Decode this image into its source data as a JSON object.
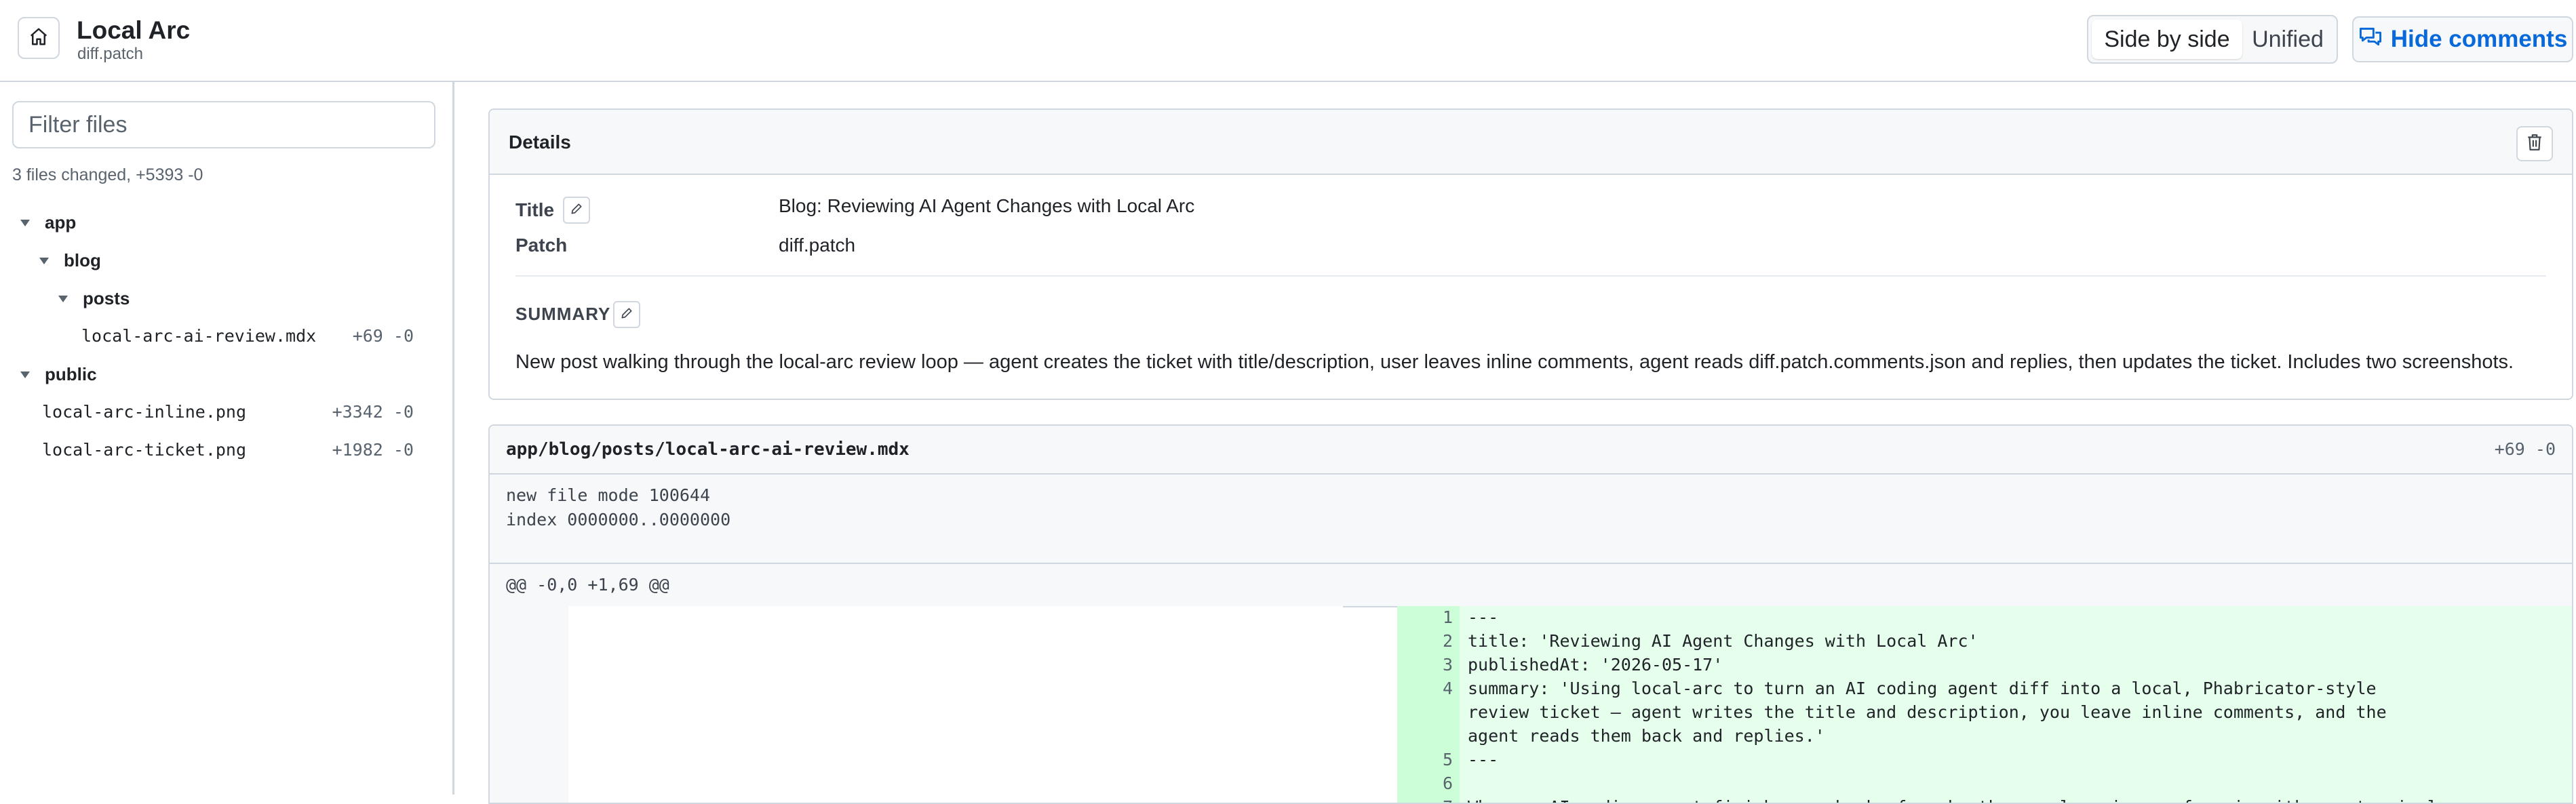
{
  "header": {
    "title": "Local Arc",
    "subtitle": "diff.patch",
    "view_modes": [
      "Side by side",
      "Unified"
    ],
    "active_view": "Side by side",
    "hide_comments_label": "Hide comments"
  },
  "sidebar": {
    "filter_placeholder": "Filter files",
    "summary": "3 files changed, +5393 -0",
    "tree": {
      "app": "app",
      "blog": "blog",
      "posts": "posts",
      "public": "public"
    },
    "files": [
      {
        "name": "local-arc-ai-review.mdx",
        "stat": "+69 -0"
      },
      {
        "name": "local-arc-inline.png",
        "stat": "+3342 -0"
      },
      {
        "name": "local-arc-ticket.png",
        "stat": "+1982 -0"
      }
    ]
  },
  "details": {
    "heading": "Details",
    "title_label": "Title",
    "title_value": "Blog: Reviewing AI Agent Changes with Local Arc",
    "patch_label": "Patch",
    "patch_value": "diff.patch",
    "summary_label": "SUMMARY",
    "summary_text": "New post walking through the local-arc review loop — agent creates the ticket with title/description, user leaves inline comments, agent reads diff.patch.comments.json and replies, then updates the ticket. Includes two screenshots."
  },
  "diff": {
    "path": "app/blog/posts/local-arc-ai-review.mdx",
    "stat": "+69 -0",
    "meta_lines": [
      "new file mode 100644",
      "index 0000000..0000000"
    ],
    "hunk_header": "@@ -0,0 +1,69 @@",
    "lines": [
      {
        "n": "1",
        "text": "---"
      },
      {
        "n": "2",
        "text": "title: 'Reviewing AI Agent Changes with Local Arc'"
      },
      {
        "n": "3",
        "text": "publishedAt: '2026-05-17'"
      },
      {
        "n": "4",
        "text": "summary: 'Using local-arc to turn an AI coding agent diff into a local, Phabricator-style"
      },
      {
        "n": "",
        "text": "review ticket — agent writes the title and description, you leave inline comments, and the"
      },
      {
        "n": "",
        "text": "agent reads them back and replies.'"
      },
      {
        "n": "5",
        "text": "---"
      },
      {
        "n": "6",
        "text": ""
      },
      {
        "n": "7",
        "text": "When an AI coding agent finishes a chunk of work, the usual review surface is either a terminal"
      }
    ]
  },
  "colors": {
    "added_bg": "#e6ffec",
    "added_gutter": "#ccffd8",
    "accent": "#0969da",
    "border": "#d0d7de"
  }
}
